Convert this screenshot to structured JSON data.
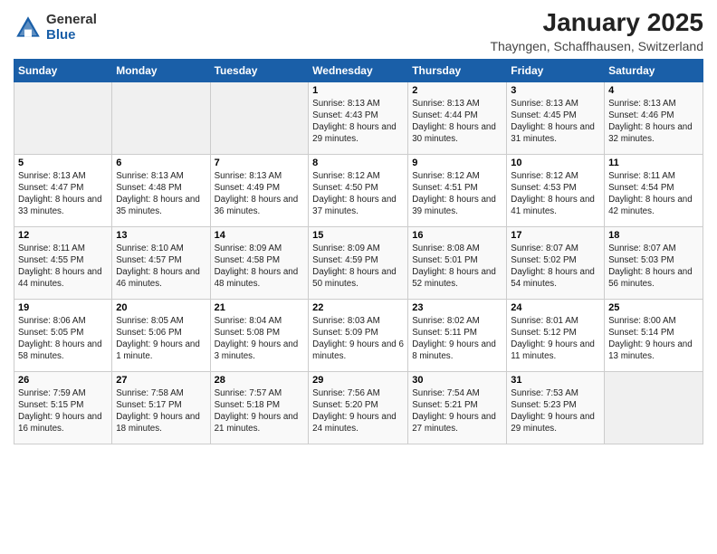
{
  "header": {
    "logo": {
      "general": "General",
      "blue": "Blue"
    },
    "title": "January 2025",
    "location": "Thayngen, Schaffhausen, Switzerland"
  },
  "days_of_week": [
    "Sunday",
    "Monday",
    "Tuesday",
    "Wednesday",
    "Thursday",
    "Friday",
    "Saturday"
  ],
  "weeks": [
    [
      {
        "day": "",
        "info": ""
      },
      {
        "day": "",
        "info": ""
      },
      {
        "day": "",
        "info": ""
      },
      {
        "day": "1",
        "info": "Sunrise: 8:13 AM\nSunset: 4:43 PM\nDaylight: 8 hours and 29 minutes."
      },
      {
        "day": "2",
        "info": "Sunrise: 8:13 AM\nSunset: 4:44 PM\nDaylight: 8 hours and 30 minutes."
      },
      {
        "day": "3",
        "info": "Sunrise: 8:13 AM\nSunset: 4:45 PM\nDaylight: 8 hours and 31 minutes."
      },
      {
        "day": "4",
        "info": "Sunrise: 8:13 AM\nSunset: 4:46 PM\nDaylight: 8 hours and 32 minutes."
      }
    ],
    [
      {
        "day": "5",
        "info": "Sunrise: 8:13 AM\nSunset: 4:47 PM\nDaylight: 8 hours and 33 minutes."
      },
      {
        "day": "6",
        "info": "Sunrise: 8:13 AM\nSunset: 4:48 PM\nDaylight: 8 hours and 35 minutes."
      },
      {
        "day": "7",
        "info": "Sunrise: 8:13 AM\nSunset: 4:49 PM\nDaylight: 8 hours and 36 minutes."
      },
      {
        "day": "8",
        "info": "Sunrise: 8:12 AM\nSunset: 4:50 PM\nDaylight: 8 hours and 37 minutes."
      },
      {
        "day": "9",
        "info": "Sunrise: 8:12 AM\nSunset: 4:51 PM\nDaylight: 8 hours and 39 minutes."
      },
      {
        "day": "10",
        "info": "Sunrise: 8:12 AM\nSunset: 4:53 PM\nDaylight: 8 hours and 41 minutes."
      },
      {
        "day": "11",
        "info": "Sunrise: 8:11 AM\nSunset: 4:54 PM\nDaylight: 8 hours and 42 minutes."
      }
    ],
    [
      {
        "day": "12",
        "info": "Sunrise: 8:11 AM\nSunset: 4:55 PM\nDaylight: 8 hours and 44 minutes."
      },
      {
        "day": "13",
        "info": "Sunrise: 8:10 AM\nSunset: 4:57 PM\nDaylight: 8 hours and 46 minutes."
      },
      {
        "day": "14",
        "info": "Sunrise: 8:09 AM\nSunset: 4:58 PM\nDaylight: 8 hours and 48 minutes."
      },
      {
        "day": "15",
        "info": "Sunrise: 8:09 AM\nSunset: 4:59 PM\nDaylight: 8 hours and 50 minutes."
      },
      {
        "day": "16",
        "info": "Sunrise: 8:08 AM\nSunset: 5:01 PM\nDaylight: 8 hours and 52 minutes."
      },
      {
        "day": "17",
        "info": "Sunrise: 8:07 AM\nSunset: 5:02 PM\nDaylight: 8 hours and 54 minutes."
      },
      {
        "day": "18",
        "info": "Sunrise: 8:07 AM\nSunset: 5:03 PM\nDaylight: 8 hours and 56 minutes."
      }
    ],
    [
      {
        "day": "19",
        "info": "Sunrise: 8:06 AM\nSunset: 5:05 PM\nDaylight: 8 hours and 58 minutes."
      },
      {
        "day": "20",
        "info": "Sunrise: 8:05 AM\nSunset: 5:06 PM\nDaylight: 9 hours and 1 minute."
      },
      {
        "day": "21",
        "info": "Sunrise: 8:04 AM\nSunset: 5:08 PM\nDaylight: 9 hours and 3 minutes."
      },
      {
        "day": "22",
        "info": "Sunrise: 8:03 AM\nSunset: 5:09 PM\nDaylight: 9 hours and 6 minutes."
      },
      {
        "day": "23",
        "info": "Sunrise: 8:02 AM\nSunset: 5:11 PM\nDaylight: 9 hours and 8 minutes."
      },
      {
        "day": "24",
        "info": "Sunrise: 8:01 AM\nSunset: 5:12 PM\nDaylight: 9 hours and 11 minutes."
      },
      {
        "day": "25",
        "info": "Sunrise: 8:00 AM\nSunset: 5:14 PM\nDaylight: 9 hours and 13 minutes."
      }
    ],
    [
      {
        "day": "26",
        "info": "Sunrise: 7:59 AM\nSunset: 5:15 PM\nDaylight: 9 hours and 16 minutes."
      },
      {
        "day": "27",
        "info": "Sunrise: 7:58 AM\nSunset: 5:17 PM\nDaylight: 9 hours and 18 minutes."
      },
      {
        "day": "28",
        "info": "Sunrise: 7:57 AM\nSunset: 5:18 PM\nDaylight: 9 hours and 21 minutes."
      },
      {
        "day": "29",
        "info": "Sunrise: 7:56 AM\nSunset: 5:20 PM\nDaylight: 9 hours and 24 minutes."
      },
      {
        "day": "30",
        "info": "Sunrise: 7:54 AM\nSunset: 5:21 PM\nDaylight: 9 hours and 27 minutes."
      },
      {
        "day": "31",
        "info": "Sunrise: 7:53 AM\nSunset: 5:23 PM\nDaylight: 9 hours and 29 minutes."
      },
      {
        "day": "",
        "info": ""
      }
    ]
  ]
}
